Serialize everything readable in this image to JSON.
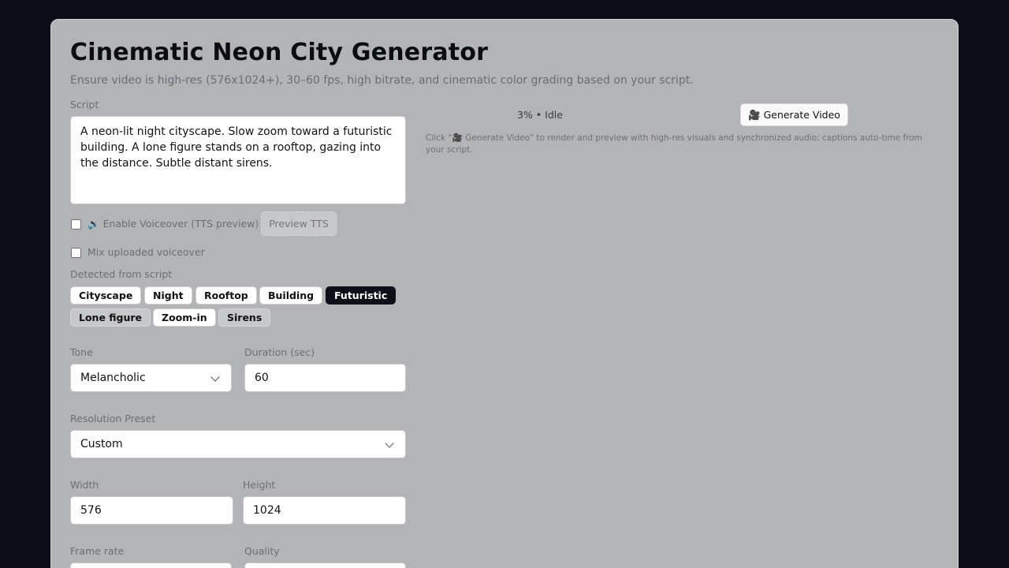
{
  "header": {
    "title": "Cinematic Neon City Generator",
    "subtitle": "Ensure video is high-res (576x1024+), 30–60 fps, high bitrate, and cinematic color grading based on your script."
  },
  "script": {
    "label": "Script",
    "value": "A neon-lit night cityscape. Slow zoom toward a futuristic building. A lone figure stands on a rooftop, gazing into the distance. Subtle distant sirens."
  },
  "voiceover": {
    "enable_label": "Enable Voiceover (TTS preview)",
    "speaker_glyph": "🔈",
    "preview_label": "Preview TTS",
    "mix_label": "Mix uploaded voiceover"
  },
  "detected": {
    "label": "Detected from script",
    "chips": [
      "Cityscape",
      "Night",
      "Rooftop",
      "Building",
      "Futuristic",
      "Lone figure",
      "Zoom-in",
      "Sirens"
    ],
    "active_chip": "Futuristic"
  },
  "form": {
    "tone_label": "Tone",
    "tone_value": "Melancholic",
    "duration_label": "Duration (sec)",
    "duration_value": "60",
    "resolution_label": "Resolution Preset",
    "resolution_value": "Custom",
    "width_label": "Width",
    "width_value": "576",
    "height_label": "Height",
    "height_value": "1024",
    "framerate_label": "Frame rate",
    "quality_label": "Quality"
  },
  "render": {
    "status": "3% • Idle",
    "progress_percent": 3,
    "generate_label": "🎥 Generate Video",
    "hint": "Click “🎥 Generate Video” to render and preview with high-res visuals and synchronized audio; captions auto-time from your script."
  },
  "colors": {
    "background": "#0b0e17",
    "panel": "#b3b4b8",
    "active_chip": "#0d1019"
  }
}
